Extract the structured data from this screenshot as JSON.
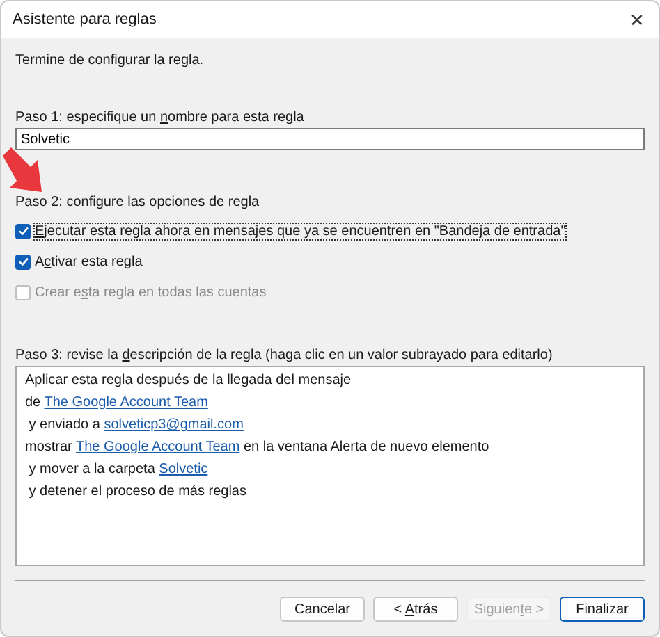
{
  "window": {
    "title": "Asistente para reglas",
    "close": "✕"
  },
  "intro": "Termine de configurar la regla.",
  "step1": {
    "label": {
      "pre": "Paso 1: especifique un ",
      "key": "n",
      "post": "ombre para esta regla"
    },
    "value": "Solvetic"
  },
  "step2": {
    "label": {
      "pre": "Paso 2: configure las opciones de regla"
    },
    "options": [
      {
        "label": {
          "key": "E",
          "post": "jecutar esta regla ahora en mensajes que ya se encuentren en \"Bandeja de entrada\""
        },
        "checked": true,
        "disabled": false,
        "focused": true
      },
      {
        "label": {
          "pre": "A",
          "key": "c",
          "post": "tivar esta regla"
        },
        "checked": true,
        "disabled": false,
        "focused": false
      },
      {
        "label": {
          "pre": "Crear e",
          "key": "s",
          "post": "ta regla en todas las cuentas"
        },
        "checked": false,
        "disabled": true,
        "focused": false
      }
    ]
  },
  "step3": {
    "label": {
      "pre": "Paso 3: revise la ",
      "key": "d",
      "post": "escripción de la regla (haga clic en un valor subrayado para editarlo)"
    },
    "lines": [
      [
        {
          "kind": "text",
          "text": "Aplicar esta regla después de la llegada del mensaje"
        }
      ],
      [
        {
          "kind": "text",
          "text": "de "
        },
        {
          "kind": "link",
          "text": "The Google Account Team"
        }
      ],
      [
        {
          "kind": "text",
          "text": " y enviado a "
        },
        {
          "kind": "link",
          "text": "solveticp3@gmail.com"
        }
      ],
      [
        {
          "kind": "text",
          "text": "mostrar "
        },
        {
          "kind": "link",
          "text": "The Google Account Team"
        },
        {
          "kind": "text",
          "text": " en la ventana Alerta de nuevo elemento"
        }
      ],
      [
        {
          "kind": "text",
          "text": " y mover a la carpeta "
        },
        {
          "kind": "link",
          "text": "Solvetic"
        }
      ],
      [
        {
          "kind": "text",
          "text": " y detener el proceso de más reglas"
        }
      ]
    ]
  },
  "buttons": [
    {
      "label": {
        "post": "Cancelar"
      },
      "disabled": false,
      "default": false
    },
    {
      "label": {
        "pre": "< ",
        "key": "A",
        "post": "trás"
      },
      "disabled": false,
      "default": false
    },
    {
      "label": {
        "pre": "Siguien",
        "key": "t",
        "post": "e >"
      },
      "disabled": true,
      "default": false
    },
    {
      "label": {
        "post": "Finalizar"
      },
      "disabled": false,
      "default": true
    }
  ]
}
